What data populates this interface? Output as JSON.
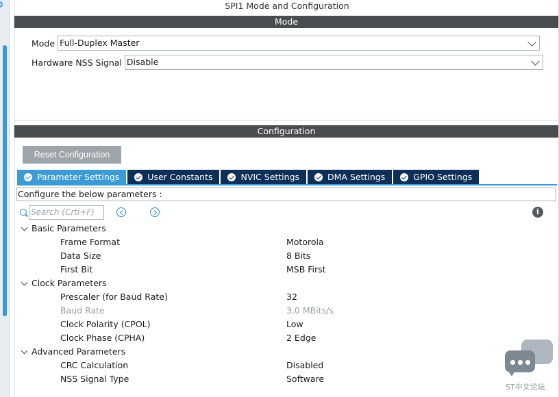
{
  "window": {
    "title": "SPI1 Mode and Configuration"
  },
  "mode_section": {
    "title": "Mode",
    "mode_label": "Mode",
    "mode_value": "Full-Duplex Master",
    "nss_label": "Hardware NSS Signal",
    "nss_value": "Disable"
  },
  "config_section": {
    "title": "Configuration",
    "reset_button": "Reset Configuration",
    "tabs": [
      {
        "label": "Parameter Settings",
        "active": true
      },
      {
        "label": "User Constants",
        "active": false
      },
      {
        "label": "NVIC Settings",
        "active": false
      },
      {
        "label": "DMA Settings",
        "active": false
      },
      {
        "label": "GPIO Settings",
        "active": false
      }
    ],
    "hint": "Configure the below parameters :",
    "search_placeholder": "Search (Crtl+F)"
  },
  "parameters": {
    "basic": {
      "label": "Basic Parameters",
      "items": [
        {
          "name": "Frame Format",
          "value": "Motorola"
        },
        {
          "name": "Data Size",
          "value": "8 Bits"
        },
        {
          "name": "First Bit",
          "value": "MSB First"
        }
      ]
    },
    "clock": {
      "label": "Clock Parameters",
      "items": [
        {
          "name": "Prescaler (for Baud Rate)",
          "value": "32"
        },
        {
          "name": "Baud Rate",
          "value": "3.0 MBits/s",
          "disabled": true
        },
        {
          "name": "Clock Polarity (CPOL)",
          "value": "Low"
        },
        {
          "name": "Clock Phase (CPHA)",
          "value": "2 Edge"
        }
      ]
    },
    "advanced": {
      "label": "Advanced Parameters",
      "items": [
        {
          "name": "CRC Calculation",
          "value": "Disabled"
        },
        {
          "name": "NSS Signal Type",
          "value": "Software"
        }
      ]
    }
  },
  "watermark": {
    "text": "ST中文论坛"
  },
  "colors": {
    "section_bar": "#4a4d50",
    "tab_active": "#3b9bd4",
    "tab_inactive": "#0e2f57",
    "reset_button": "#9ea4aa",
    "accent_icon": "#2b8fd0"
  }
}
